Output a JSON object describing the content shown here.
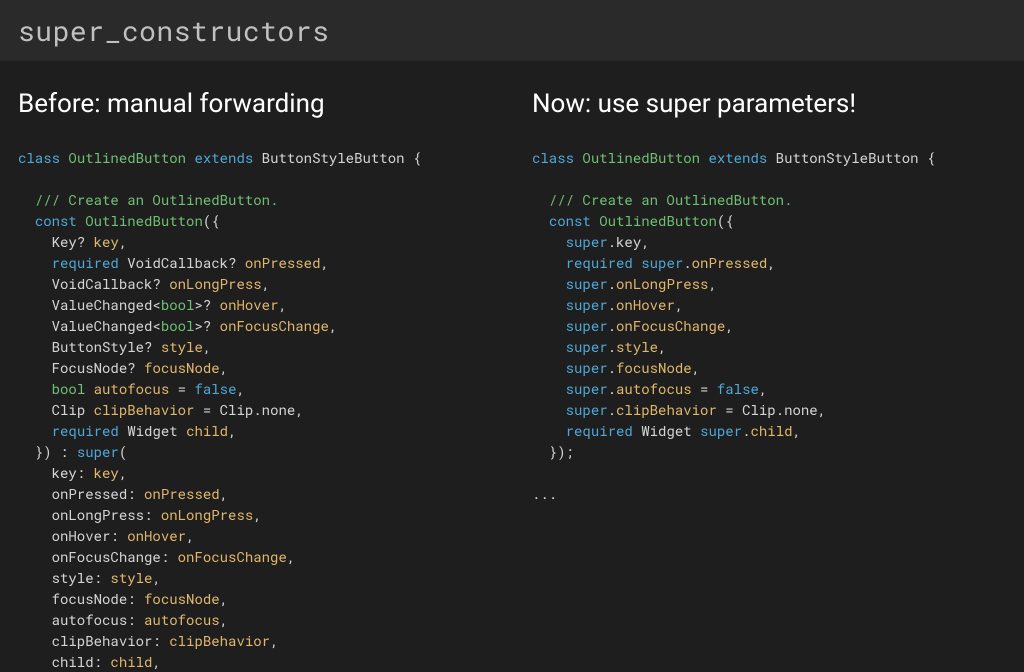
{
  "header": {
    "title": "super_constructors"
  },
  "left": {
    "title": "Before: manual forwarding",
    "code_tokens": [
      {
        "c": "kw",
        "t": "class"
      },
      {
        "t": " "
      },
      {
        "c": "cls",
        "t": "OutlinedButton"
      },
      {
        "t": " "
      },
      {
        "c": "kw",
        "t": "extends"
      },
      {
        "t": " "
      },
      {
        "c": "typ",
        "t": "ButtonStyleButton"
      },
      {
        "t": " {"
      },
      {
        "nl": true
      },
      {
        "nl": true
      },
      {
        "t": "  "
      },
      {
        "c": "comm",
        "t": "/// Create an OutlinedButton."
      },
      {
        "nl": true
      },
      {
        "t": "  "
      },
      {
        "c": "kw",
        "t": "const"
      },
      {
        "t": " "
      },
      {
        "c": "cls",
        "t": "OutlinedButton"
      },
      {
        "t": "({"
      },
      {
        "nl": true
      },
      {
        "t": "    "
      },
      {
        "c": "typ",
        "t": "Key"
      },
      {
        "c": "op",
        "t": "?"
      },
      {
        "t": " "
      },
      {
        "c": "param",
        "t": "key"
      },
      {
        "t": ","
      },
      {
        "nl": true
      },
      {
        "t": "    "
      },
      {
        "c": "kw",
        "t": "required"
      },
      {
        "t": " "
      },
      {
        "c": "typ",
        "t": "VoidCallback"
      },
      {
        "c": "op",
        "t": "?"
      },
      {
        "t": " "
      },
      {
        "c": "param",
        "t": "onPressed"
      },
      {
        "t": ","
      },
      {
        "nl": true
      },
      {
        "t": "    "
      },
      {
        "c": "typ",
        "t": "VoidCallback"
      },
      {
        "c": "op",
        "t": "?"
      },
      {
        "t": " "
      },
      {
        "c": "param",
        "t": "onLongPress"
      },
      {
        "t": ","
      },
      {
        "nl": true
      },
      {
        "t": "    "
      },
      {
        "c": "typ",
        "t": "ValueChanged"
      },
      {
        "c": "op",
        "t": "<"
      },
      {
        "c": "builtin",
        "t": "bool"
      },
      {
        "c": "op",
        "t": ">?"
      },
      {
        "t": " "
      },
      {
        "c": "param",
        "t": "onHover"
      },
      {
        "t": ","
      },
      {
        "nl": true
      },
      {
        "t": "    "
      },
      {
        "c": "typ",
        "t": "ValueChanged"
      },
      {
        "c": "op",
        "t": "<"
      },
      {
        "c": "builtin",
        "t": "bool"
      },
      {
        "c": "op",
        "t": ">?"
      },
      {
        "t": " "
      },
      {
        "c": "param",
        "t": "onFocusChange"
      },
      {
        "t": ","
      },
      {
        "nl": true
      },
      {
        "t": "    "
      },
      {
        "c": "typ",
        "t": "ButtonStyle"
      },
      {
        "c": "op",
        "t": "?"
      },
      {
        "t": " "
      },
      {
        "c": "param",
        "t": "style"
      },
      {
        "t": ","
      },
      {
        "nl": true
      },
      {
        "t": "    "
      },
      {
        "c": "typ",
        "t": "FocusNode"
      },
      {
        "c": "op",
        "t": "?"
      },
      {
        "t": " "
      },
      {
        "c": "param",
        "t": "focusNode"
      },
      {
        "t": ","
      },
      {
        "nl": true
      },
      {
        "t": "    "
      },
      {
        "c": "builtin",
        "t": "bool"
      },
      {
        "t": " "
      },
      {
        "c": "param",
        "t": "autofocus"
      },
      {
        "t": " = "
      },
      {
        "c": "lit",
        "t": "false"
      },
      {
        "t": ","
      },
      {
        "nl": true
      },
      {
        "t": "    "
      },
      {
        "c": "typ",
        "t": "Clip"
      },
      {
        "t": " "
      },
      {
        "c": "param",
        "t": "clipBehavior"
      },
      {
        "t": " = Clip.none,"
      },
      {
        "nl": true
      },
      {
        "t": "    "
      },
      {
        "c": "kw",
        "t": "required"
      },
      {
        "t": " "
      },
      {
        "c": "typ",
        "t": "Widget"
      },
      {
        "t": " "
      },
      {
        "c": "param",
        "t": "child"
      },
      {
        "t": ","
      },
      {
        "nl": true
      },
      {
        "t": "  }) : "
      },
      {
        "c": "kw",
        "t": "super"
      },
      {
        "t": "("
      },
      {
        "nl": true
      },
      {
        "t": "    key: "
      },
      {
        "c": "param",
        "t": "key"
      },
      {
        "t": ","
      },
      {
        "nl": true
      },
      {
        "t": "    onPressed: "
      },
      {
        "c": "param",
        "t": "onPressed"
      },
      {
        "t": ","
      },
      {
        "nl": true
      },
      {
        "t": "    onLongPress: "
      },
      {
        "c": "param",
        "t": "onLongPress"
      },
      {
        "t": ","
      },
      {
        "nl": true
      },
      {
        "t": "    onHover: "
      },
      {
        "c": "param",
        "t": "onHover"
      },
      {
        "t": ","
      },
      {
        "nl": true
      },
      {
        "t": "    onFocusChange: "
      },
      {
        "c": "param",
        "t": "onFocusChange"
      },
      {
        "t": ","
      },
      {
        "nl": true
      },
      {
        "t": "    style: "
      },
      {
        "c": "param",
        "t": "style"
      },
      {
        "t": ","
      },
      {
        "nl": true
      },
      {
        "t": "    focusNode: "
      },
      {
        "c": "param",
        "t": "focusNode"
      },
      {
        "t": ","
      },
      {
        "nl": true
      },
      {
        "t": "    autofocus: "
      },
      {
        "c": "param",
        "t": "autofocus"
      },
      {
        "t": ","
      },
      {
        "nl": true
      },
      {
        "t": "    clipBehavior: "
      },
      {
        "c": "param",
        "t": "clipBehavior"
      },
      {
        "t": ","
      },
      {
        "nl": true
      },
      {
        "t": "    child: "
      },
      {
        "c": "param",
        "t": "child"
      },
      {
        "t": ","
      }
    ]
  },
  "right": {
    "title": "Now: use super parameters!",
    "code_tokens": [
      {
        "c": "kw",
        "t": "class"
      },
      {
        "t": " "
      },
      {
        "c": "cls",
        "t": "OutlinedButton"
      },
      {
        "t": " "
      },
      {
        "c": "kw",
        "t": "extends"
      },
      {
        "t": " "
      },
      {
        "c": "typ",
        "t": "ButtonStyleButton"
      },
      {
        "t": " {"
      },
      {
        "nl": true
      },
      {
        "nl": true
      },
      {
        "t": "  "
      },
      {
        "c": "comm",
        "t": "/// Create an OutlinedButton."
      },
      {
        "nl": true
      },
      {
        "t": "  "
      },
      {
        "c": "kw",
        "t": "const"
      },
      {
        "t": " "
      },
      {
        "c": "cls",
        "t": "OutlinedButton"
      },
      {
        "t": "({"
      },
      {
        "nl": true
      },
      {
        "t": "    "
      },
      {
        "c": "kw",
        "t": "super"
      },
      {
        "t": ".key,"
      },
      {
        "nl": true
      },
      {
        "t": "    "
      },
      {
        "c": "kw",
        "t": "required"
      },
      {
        "t": " "
      },
      {
        "c": "kw",
        "t": "super"
      },
      {
        "t": "."
      },
      {
        "c": "param",
        "t": "onPressed"
      },
      {
        "t": ","
      },
      {
        "nl": true
      },
      {
        "t": "    "
      },
      {
        "c": "kw",
        "t": "super"
      },
      {
        "t": "."
      },
      {
        "c": "param",
        "t": "onLongPress"
      },
      {
        "t": ","
      },
      {
        "nl": true
      },
      {
        "t": "    "
      },
      {
        "c": "kw",
        "t": "super"
      },
      {
        "t": "."
      },
      {
        "c": "param",
        "t": "onHover"
      },
      {
        "t": ","
      },
      {
        "nl": true
      },
      {
        "t": "    "
      },
      {
        "c": "kw",
        "t": "super"
      },
      {
        "t": "."
      },
      {
        "c": "param",
        "t": "onFocusChange"
      },
      {
        "t": ","
      },
      {
        "nl": true
      },
      {
        "t": "    "
      },
      {
        "c": "kw",
        "t": "super"
      },
      {
        "t": "."
      },
      {
        "c": "param",
        "t": "style"
      },
      {
        "t": ","
      },
      {
        "nl": true
      },
      {
        "t": "    "
      },
      {
        "c": "kw",
        "t": "super"
      },
      {
        "t": "."
      },
      {
        "c": "param",
        "t": "focusNode"
      },
      {
        "t": ","
      },
      {
        "nl": true
      },
      {
        "t": "    "
      },
      {
        "c": "kw",
        "t": "super"
      },
      {
        "t": "."
      },
      {
        "c": "param",
        "t": "autofocus"
      },
      {
        "t": " = "
      },
      {
        "c": "lit",
        "t": "false"
      },
      {
        "t": ","
      },
      {
        "nl": true
      },
      {
        "t": "    "
      },
      {
        "c": "kw",
        "t": "super"
      },
      {
        "t": "."
      },
      {
        "c": "param",
        "t": "clipBehavior"
      },
      {
        "t": " = Clip.none,"
      },
      {
        "nl": true
      },
      {
        "t": "    "
      },
      {
        "c": "kw",
        "t": "required"
      },
      {
        "t": " "
      },
      {
        "c": "typ",
        "t": "Widget"
      },
      {
        "t": " "
      },
      {
        "c": "kw",
        "t": "super"
      },
      {
        "t": "."
      },
      {
        "c": "param",
        "t": "child"
      },
      {
        "t": ","
      },
      {
        "nl": true
      },
      {
        "t": "  });"
      },
      {
        "nl": true
      },
      {
        "nl": true
      },
      {
        "t": "..."
      }
    ]
  }
}
